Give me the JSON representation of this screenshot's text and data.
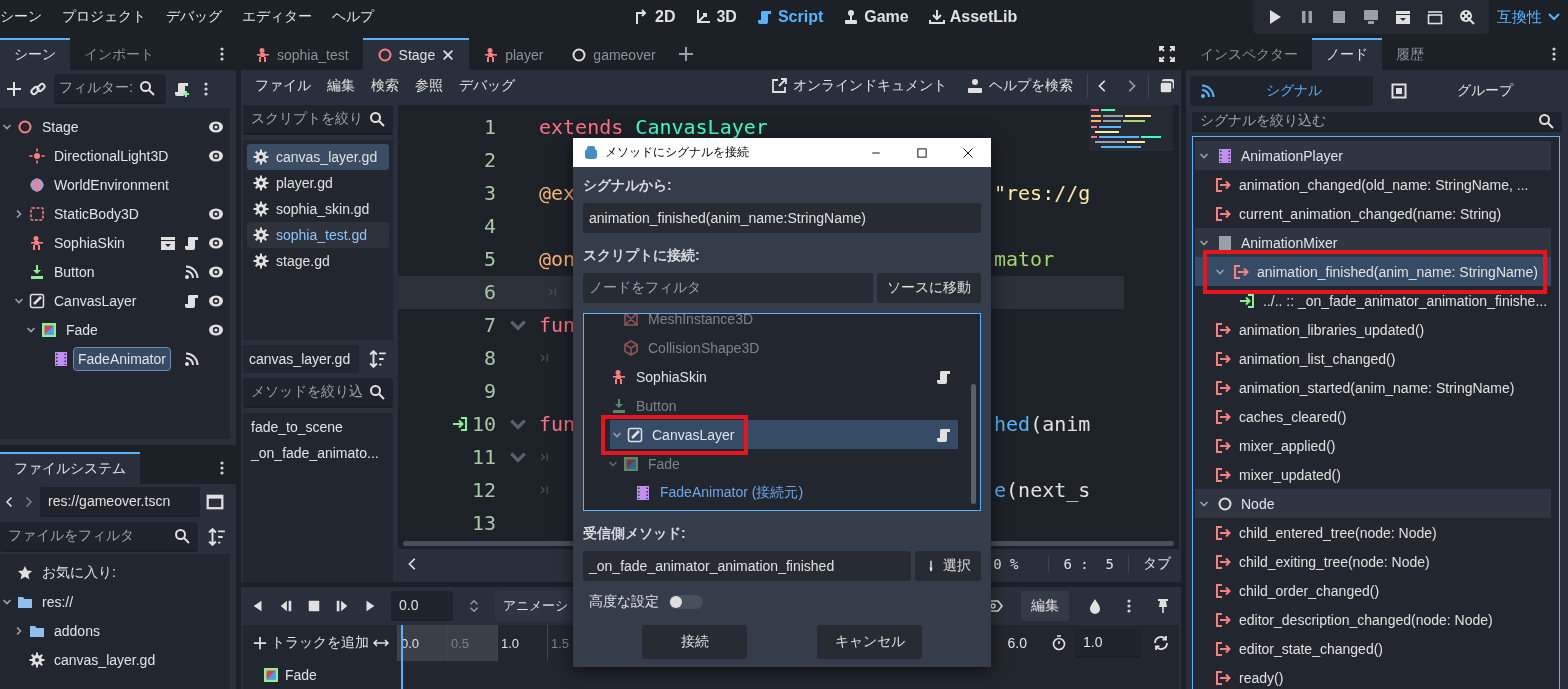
{
  "menu": [
    "シーン",
    "プロジェクト",
    "デバッグ",
    "エディター",
    "ヘルプ"
  ],
  "workspaces": [
    {
      "label": "2D",
      "kind": "plane",
      "selected": false
    },
    {
      "label": "3D",
      "kind": "space",
      "selected": false
    },
    {
      "label": "Script",
      "kind": "script",
      "selected": true
    },
    {
      "label": "Game",
      "kind": "game",
      "selected": false
    },
    {
      "label": "AssetLib",
      "kind": "assetlib",
      "selected": false
    }
  ],
  "renderer": "互換性",
  "scene_dock": {
    "tabs": [
      {
        "label": "シーン",
        "selected": true
      },
      {
        "label": "インポート",
        "selected": false
      }
    ],
    "filter": {
      "placeholder": "フィルター:"
    },
    "tree": [
      {
        "name": "Stage",
        "kind": "root",
        "expanded": true,
        "selected": false,
        "eye": true,
        "script": false,
        "signals": false,
        "scene_instance": false,
        "children": [
          {
            "name": "DirectionalLight3D",
            "kind": "light",
            "selected": false,
            "eye": true,
            "script": false,
            "signals": false,
            "scene_instance": false
          },
          {
            "name": "WorldEnvironment",
            "kind": "environment",
            "selected": false,
            "eye": false,
            "script": false,
            "signals": false,
            "scene_instance": false
          },
          {
            "name": "StaticBody3D",
            "kind": "body",
            "expanded": false,
            "selected": false,
            "eye": true,
            "script": false,
            "signals": false,
            "scene_instance": false
          },
          {
            "name": "SophiaSkin",
            "kind": "character",
            "selected": false,
            "eye": true,
            "script": true,
            "signals": false,
            "scene_instance": true
          },
          {
            "name": "Button",
            "kind": "button",
            "selected": false,
            "eye": true,
            "script": false,
            "signals": true,
            "scene_instance": false
          },
          {
            "name": "CanvasLayer",
            "kind": "canvas",
            "expanded": true,
            "selected": false,
            "eye": true,
            "script": true,
            "signals": false,
            "scene_instance": false,
            "children": [
              {
                "name": "Fade",
                "kind": "colorrect",
                "expanded": true,
                "selected": false,
                "eye": true,
                "script": false,
                "signals": false,
                "scene_instance": false,
                "children": [
                  {
                    "name": "FadeAnimator",
                    "kind": "animation",
                    "selected": true,
                    "eye": false,
                    "script": false,
                    "signals": true,
                    "scene_instance": false
                  }
                ]
              }
            ]
          }
        ]
      }
    ]
  },
  "filesystem": {
    "tab": "ファイルシステム",
    "path": "res://gameover.tscn",
    "filter": {
      "placeholder": "ファイルをフィルタ"
    },
    "items": [
      {
        "name": "お気に入り:",
        "kind": "favorites"
      },
      {
        "name": "res://",
        "kind": "folder",
        "expanded": true,
        "children": [
          {
            "name": "addons",
            "kind": "folder",
            "expanded": false
          },
          {
            "name": "canvas_layer.gd",
            "kind": "script"
          }
        ]
      }
    ]
  },
  "script_tabs": [
    {
      "label": "sophia_test",
      "kind": "character",
      "selected": false
    },
    {
      "label": "Stage",
      "kind": "root",
      "selected": true
    },
    {
      "label": "player",
      "kind": "character",
      "selected": false
    },
    {
      "label": "gameover",
      "kind": "node",
      "selected": false
    }
  ],
  "script_menu": [
    "ファイル",
    "編集",
    "検索",
    "参照",
    "デバッグ"
  ],
  "script_tools": {
    "docs": "オンラインドキュメント",
    "help": "ヘルプを検索"
  },
  "script_list": {
    "filter": {
      "placeholder": "スクリプトを絞り"
    },
    "items": [
      {
        "name": "canvas_layer.gd",
        "selected": true,
        "open_scene": false
      },
      {
        "name": "player.gd",
        "selected": false,
        "open_scene": false
      },
      {
        "name": "sophia_skin.gd",
        "selected": false,
        "open_scene": false
      },
      {
        "name": "sophia_test.gd",
        "selected": false,
        "open_scene": true
      },
      {
        "name": "stage.gd",
        "selected": false,
        "open_scene": false
      }
    ],
    "current": "canvas_layer.gd",
    "method_filter": {
      "placeholder": "メソッドを絞り込"
    },
    "methods": [
      "fade_to_scene",
      "_on_fade_animato..."
    ]
  },
  "editor": {
    "lines": [
      {
        "number": "1",
        "current": false,
        "foldable": false,
        "tab_marker": false,
        "connected": false,
        "left": [
          {
            "text": "extends",
            "kind": "keyword"
          },
          {
            "text": " CanvasLayer",
            "kind": "type"
          }
        ]
      },
      {
        "number": "2",
        "current": false,
        "foldable": false,
        "tab_marker": false,
        "connected": false
      },
      {
        "number": "3",
        "current": false,
        "foldable": false,
        "tab_marker": false,
        "connected": false,
        "left": [
          {
            "text": "@ex",
            "kind": "annotation"
          }
        ],
        "right": [
          {
            "text": "\"res://g",
            "kind": "string"
          }
        ]
      },
      {
        "number": "4",
        "current": false,
        "foldable": false,
        "tab_marker": false,
        "connected": false
      },
      {
        "number": "5",
        "current": false,
        "foldable": false,
        "tab_marker": false,
        "connected": false,
        "left": [
          {
            "text": "@on",
            "kind": "annotation"
          }
        ],
        "right": [
          {
            "text": "mator",
            "kind": "nodepath"
          }
        ]
      },
      {
        "number": "6",
        "current": true,
        "foldable": false,
        "tab_marker": true,
        "connected": false
      },
      {
        "number": "7",
        "current": false,
        "foldable": true,
        "tab_marker": false,
        "connected": false,
        "left": [
          {
            "text": "fun",
            "kind": "keyword"
          }
        ]
      },
      {
        "number": "8",
        "current": false,
        "foldable": false,
        "tab_marker": true,
        "connected": false
      },
      {
        "number": "9",
        "current": false,
        "foldable": false,
        "tab_marker": false,
        "connected": false
      },
      {
        "number": "10",
        "current": false,
        "foldable": true,
        "tab_marker": false,
        "connected": true,
        "left": [
          {
            "text": "fun",
            "kind": "keyword"
          }
        ],
        "right": [
          {
            "text": "hed",
            "kind": "function"
          },
          {
            "text": "(anim",
            "kind": "plain"
          }
        ]
      },
      {
        "number": "11",
        "current": false,
        "foldable": true,
        "tab_marker": true,
        "connected": false
      },
      {
        "number": "12",
        "current": false,
        "foldable": false,
        "tab_marker": true,
        "connected": false,
        "right": [
          {
            "text": "e",
            "kind": "function"
          },
          {
            "text": "(next_s",
            "kind": "plain"
          }
        ]
      },
      {
        "number": "13",
        "current": false,
        "foldable": false,
        "tab_marker": false,
        "connected": false
      }
    ],
    "status": {
      "zoom": "0 %",
      "position": "6 :  5",
      "indent": "タブ"
    }
  },
  "animation": {
    "time": "0.0",
    "animation_select": "アニメーシ",
    "edit": "編集",
    "add_track": "トラックを追加",
    "ruler": [
      {
        "label": "0.0",
        "major": true
      },
      {
        "label": "0.5",
        "major": false
      },
      {
        "label": "1.0",
        "major": true
      },
      {
        "label": "1.5",
        "major": false
      }
    ],
    "ruler_end": "6.0",
    "length": "1.0",
    "tracks": [
      {
        "name": "Fade",
        "kind": "colorrect"
      }
    ]
  },
  "inspector_dock": {
    "tabs": [
      {
        "label": "インスペクター",
        "selected": false
      },
      {
        "label": "ノード",
        "selected": true
      },
      {
        "label": "履歴",
        "selected": false
      }
    ],
    "subtabs": [
      {
        "label": "シグナル",
        "kind": "signals",
        "selected": true
      },
      {
        "label": "グループ",
        "kind": "groups",
        "selected": false
      }
    ],
    "filter": {
      "placeholder": "シグナルを絞り込む"
    },
    "signals": [
      {
        "class": "AnimationPlayer",
        "kind": "animation",
        "expanded": true,
        "children": [
          {
            "name": "animation_changed(old_name: StringName, ...",
            "kind": "signal",
            "selected": false,
            "annotated": false
          },
          {
            "name": "current_animation_changed(name: String)",
            "kind": "signal",
            "selected": false,
            "annotated": false
          }
        ]
      },
      {
        "class": "AnimationMixer",
        "kind": "mixer",
        "expanded": true,
        "children": [
          {
            "name": "animation_finished(anim_name: StringName)",
            "kind": "signal",
            "selected": true,
            "annotated": true,
            "expanded": true,
            "children": [
              {
                "name": "../.. :: _on_fade_animator_animation_finishe...",
                "kind": "connection",
                "selected": false,
                "annotated": false
              }
            ]
          },
          {
            "name": "animation_libraries_updated()",
            "kind": "signal",
            "selected": false,
            "annotated": false
          },
          {
            "name": "animation_list_changed()",
            "kind": "signal",
            "selected": false,
            "annotated": false
          },
          {
            "name": "animation_started(anim_name: StringName)",
            "kind": "signal",
            "selected": false,
            "annotated": false
          },
          {
            "name": "caches_cleared()",
            "kind": "signal",
            "selected": false,
            "annotated": false
          },
          {
            "name": "mixer_applied()",
            "kind": "signal",
            "selected": false,
            "annotated": false
          },
          {
            "name": "mixer_updated()",
            "kind": "signal",
            "selected": false,
            "annotated": false
          }
        ]
      },
      {
        "class": "Node",
        "kind": "node",
        "expanded": true,
        "children": [
          {
            "name": "child_entered_tree(node: Node)",
            "kind": "signal",
            "selected": false,
            "annotated": false
          },
          {
            "name": "child_exiting_tree(node: Node)",
            "kind": "signal",
            "selected": false,
            "annotated": false
          },
          {
            "name": "child_order_changed()",
            "kind": "signal",
            "selected": false,
            "annotated": false
          },
          {
            "name": "editor_description_changed(node: Node)",
            "kind": "signal",
            "selected": false,
            "annotated": false
          },
          {
            "name": "editor_state_changed()",
            "kind": "signal",
            "selected": false,
            "annotated": false
          },
          {
            "name": "ready()",
            "kind": "signal",
            "selected": false,
            "annotated": false
          }
        ]
      }
    ]
  },
  "dialog": {
    "title": "メソッドにシグナルを接続",
    "from_label": "シグナルから:",
    "signal": "animation_finished(anim_name:StringName)",
    "to_label": "スクリプトに接続:",
    "node_filter": {
      "placeholder": "ノードをフィルタ"
    },
    "go_to_source": "ソースに移動",
    "nodes": [
      {
        "children": [
          {
            "name": "MeshInstance3D",
            "kind": "mesh",
            "dimmed": true,
            "selected": false,
            "script": false,
            "source": false,
            "annotated": false
          },
          {
            "name": "CollisionShape3D",
            "kind": "collision",
            "dimmed": true,
            "selected": false,
            "script": false,
            "source": false,
            "annotated": false
          }
        ]
      },
      {
        "name": "SophiaSkin",
        "kind": "character",
        "dimmed": false,
        "selected": false,
        "script": true,
        "source": false,
        "annotated": false
      },
      {
        "name": "Button",
        "kind": "button",
        "dimmed": true,
        "selected": false,
        "script": false,
        "source": false,
        "annotated": false
      },
      {
        "name": "CanvasLayer",
        "kind": "canvas",
        "expanded": true,
        "dimmed": false,
        "selected": true,
        "script": true,
        "source": false,
        "annotated": true,
        "children": [
          {
            "name": "Fade",
            "kind": "colorrect",
            "expanded": true,
            "dimmed": true,
            "selected": false,
            "script": false,
            "source": false,
            "annotated": false,
            "children": [
              {
                "name": "FadeAnimator (接続元)",
                "kind": "animation",
                "dimmed": false,
                "selected": false,
                "script": false,
                "source": true,
                "annotated": false
              }
            ]
          }
        ]
      }
    ],
    "method_label": "受信側メソッド:",
    "method": "_on_fade_animator_animation_finished",
    "pick": "選択",
    "advanced": {
      "label": "高度な設定",
      "on": false
    },
    "buttons": [
      "接続",
      "キャンセル"
    ]
  }
}
